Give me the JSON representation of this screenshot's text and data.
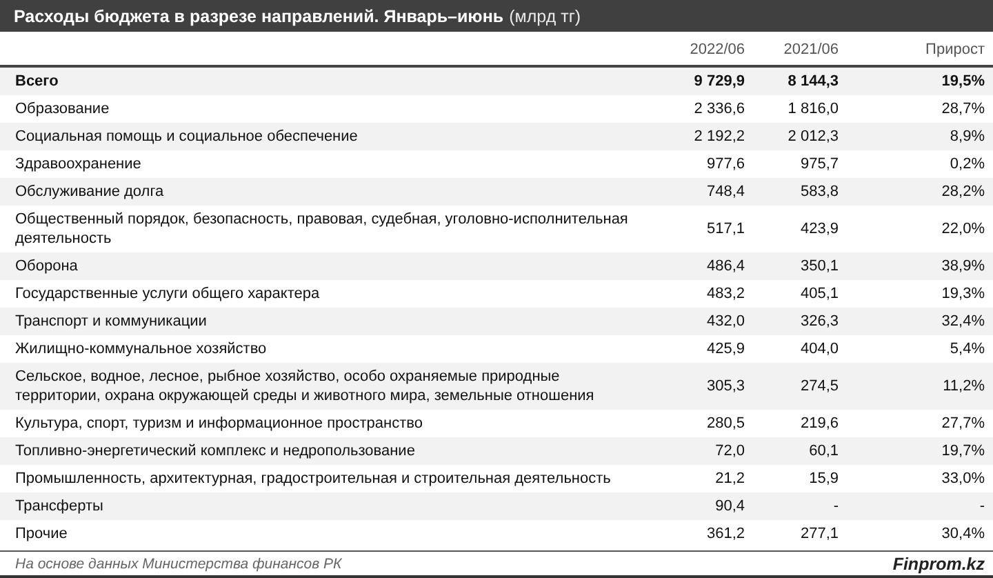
{
  "title": {
    "main": "Расходы бюджета в разрезе направлений. Январь–июнь",
    "unit": "(млрд тг)"
  },
  "columns": [
    "2022/06",
    "2021/06",
    "Прирост"
  ],
  "rows": [
    {
      "kind": "total",
      "label": "Всего",
      "values": [
        "9 729,9",
        "8 144,3",
        "19,5%"
      ]
    },
    {
      "kind": "item",
      "label": "Образование",
      "values": [
        "2 336,6",
        "1 816,0",
        "28,7%"
      ]
    },
    {
      "kind": "item",
      "label": "Социальная помощь и социальное обеспечение",
      "values": [
        "2 192,2",
        "2 012,3",
        "8,9%"
      ]
    },
    {
      "kind": "item",
      "label": "Здравоохранение",
      "values": [
        "977,6",
        "975,7",
        "0,2%"
      ]
    },
    {
      "kind": "item",
      "label": "Обслуживание долга",
      "values": [
        "748,4",
        "583,8",
        "28,2%"
      ]
    },
    {
      "kind": "item",
      "label": "Общественный порядок, безопасность, правовая, судебная, уголовно-исполнительная деятельность",
      "values": [
        "517,1",
        "423,9",
        "22,0%"
      ]
    },
    {
      "kind": "item",
      "label": "Оборона",
      "values": [
        "486,4",
        "350,1",
        "38,9%"
      ]
    },
    {
      "kind": "item",
      "label": "Государственные услуги общего характера",
      "values": [
        "483,2",
        "405,1",
        "19,3%"
      ]
    },
    {
      "kind": "item",
      "label": "Транспорт и коммуникации",
      "values": [
        "432,0",
        "326,3",
        "32,4%"
      ]
    },
    {
      "kind": "item",
      "label": "Жилищно-коммунальное хозяйство",
      "values": [
        "425,9",
        "404,0",
        "5,4%"
      ]
    },
    {
      "kind": "item",
      "label": "Сельское, водное, лесное, рыбное хозяйство, особо охраняемые природные территории, охрана окружающей среды и животного мира, земельные отношения",
      "values": [
        "305,3",
        "274,5",
        "11,2%"
      ]
    },
    {
      "kind": "item",
      "label": "Культура, спорт, туризм и информационное пространство",
      "values": [
        "280,5",
        "219,6",
        "27,7%"
      ]
    },
    {
      "kind": "item",
      "label": "Топливно-энергетический комплекс и недропользование",
      "values": [
        "72,0",
        "60,1",
        "19,7%"
      ]
    },
    {
      "kind": "item",
      "label": "Промышленность, архитектурная, градостроительная и строительная деятельность",
      "values": [
        "21,2",
        "15,9",
        "33,0%"
      ]
    },
    {
      "kind": "item",
      "label": "Трансферты",
      "values": [
        "90,4",
        "-",
        "-"
      ]
    },
    {
      "kind": "item",
      "label": "Прочие",
      "values": [
        "361,2",
        "277,1",
        "30,4%"
      ]
    }
  ],
  "footer": {
    "source": "На основе данных Министерства финансов РК",
    "brand": "Finprom.kz"
  }
}
